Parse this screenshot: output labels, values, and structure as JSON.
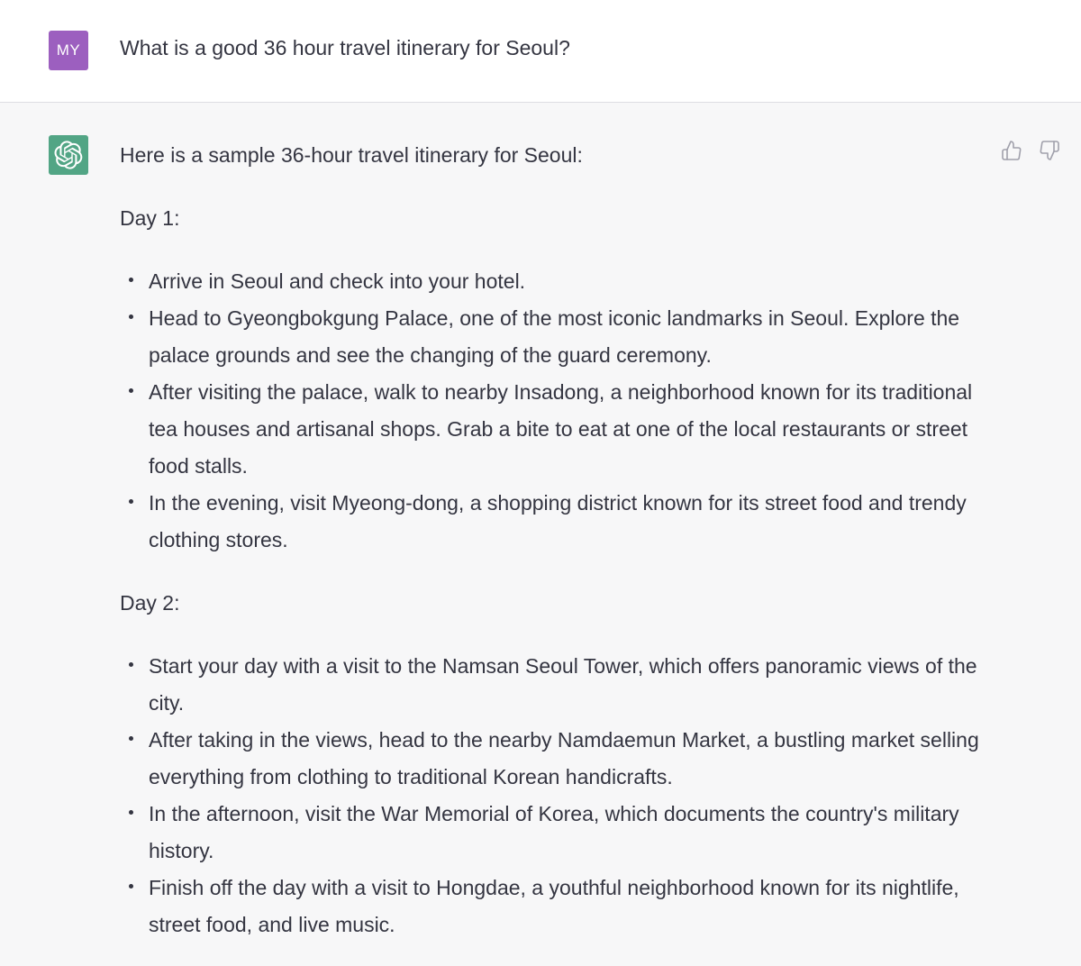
{
  "user_message": {
    "avatar_initials": "MY",
    "text": "What is a good 36 hour travel itinerary for Seoul?"
  },
  "assistant_message": {
    "avatar_icon": "openai-logo-icon",
    "feedback": {
      "thumbs_up_icon": "thumbs-up-icon",
      "thumbs_down_icon": "thumbs-down-icon"
    },
    "intro": "Here is a sample 36-hour travel itinerary for Seoul:",
    "days": [
      {
        "heading": "Day 1:",
        "items": [
          "Arrive in Seoul and check into your hotel.",
          "Head to Gyeongbokgung Palace, one of the most iconic landmarks in Seoul. Explore the palace grounds and see the changing of the guard ceremony.",
          "After visiting the palace, walk to nearby Insadong, a neighborhood known for its traditional tea houses and artisanal shops. Grab a bite to eat at one of the local restaurants or street food stalls.",
          "In the evening, visit Myeong-dong, a shopping district known for its street food and trendy clothing stores."
        ]
      },
      {
        "heading": "Day 2:",
        "items": [
          "Start your day with a visit to the Namsan Seoul Tower, which offers panoramic views of the city.",
          "After taking in the views, head to the nearby Namdaemun Market, a bustling market selling everything from clothing to traditional Korean handicrafts.",
          "In the afternoon, visit the War Memorial of Korea, which documents the country's military history.",
          "Finish off the day with a visit to Hongdae, a youthful neighborhood known for its nightlife, street food, and live music."
        ]
      }
    ]
  },
  "colors": {
    "user_avatar": "#9c5fbf",
    "bot_avatar": "#52a585",
    "assistant_bg": "#f7f7f8",
    "text": "#343541"
  }
}
